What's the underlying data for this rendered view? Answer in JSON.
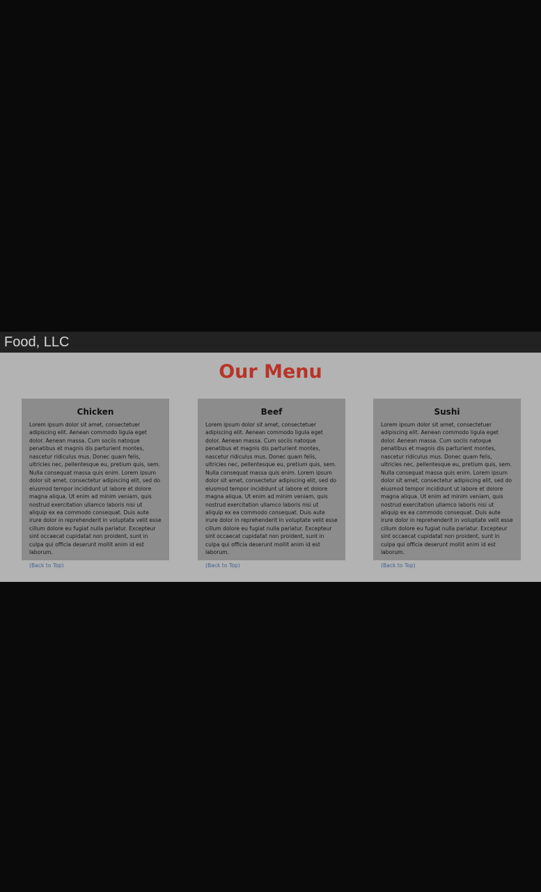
{
  "header": {
    "brand": "Food, LLC"
  },
  "menu": {
    "title": "Our Menu",
    "title_color": "#b83428",
    "cards": [
      {
        "title": "Chicken",
        "body": "Lorem ipsum dolor sit amet, consectetuer adipiscing elit. Aenean commodo ligula eget dolor. Aenean massa. Cum sociis natoque penatibus et magnis dis parturient montes, nascetur ridiculus mus. Donec quam felis, ultricies nec, pellentesque eu, pretium quis, sem. Nulla consequat massa quis enim. Lorem ipsum dolor sit amet, consectetur adipiscing elit, sed do eiusmod tempor incididunt ut labore et dolore magna aliqua. Ut enim ad minim veniam, quis nostrud exercitation ullamco laboris nisi ut aliquip ex ea commodo consequat. Duis aute irure dolor in reprehenderit in voluptate velit esse cillum dolore eu fugiat nulla pariatur. Excepteur sint occaecat cupidatat non proident, sunt in culpa qui officia deserunt mollit anim id est laborum.",
        "link": "(Back to Top)"
      },
      {
        "title": "Beef",
        "body": "Lorem ipsum dolor sit amet, consectetuer adipiscing elit. Aenean commodo ligula eget dolor. Aenean massa. Cum sociis natoque penatibus et magnis dis parturient montes, nascetur ridiculus mus. Donec quam felis, ultricies nec, pellentesque eu, pretium quis, sem. Nulla consequat massa quis enim. Lorem ipsum dolor sit amet, consectetur adipiscing elit, sed do eiusmod tempor incididunt ut labore et dolore magna aliqua. Ut enim ad minim veniam, quis nostrud exercitation ullamco laboris nisi ut aliquip ex ea commodo consequat. Duis aute irure dolor in reprehenderit in voluptate velit esse cillum dolore eu fugiat nulla pariatur. Excepteur sint occaecat cupidatat non proident, sunt in culpa qui officia deserunt mollit anim id est laborum.",
        "link": "(Back to Top)"
      },
      {
        "title": "Sushi",
        "body": "Lorem ipsum dolor sit amet, consectetuer adipiscing elit. Aenean commodo ligula eget dolor. Aenean massa. Cum sociis natoque penatibus et magnis dis parturient montes, nascetur ridiculus mus. Donec quam felis, ultricies nec, pellentesque eu, pretium quis, sem. Nulla consequat massa quis enim. Lorem ipsum dolor sit amet, consectetur adipiscing elit, sed do eiusmod tempor incididunt ut labore et dolore magna aliqua. Ut enim ad minim veniam, quis nostrud exercitation ullamco laboris nisi ut aliquip ex ea commodo consequat. Duis aute irure dolor in reprehenderit in voluptate velit esse cillum dolore eu fugiat nulla pariatur. Excepteur sint occaecat cupidatat non proident, sunt in culpa qui officia deserunt mollit anim id est laborum.",
        "link": "(Back to Top)"
      }
    ]
  }
}
